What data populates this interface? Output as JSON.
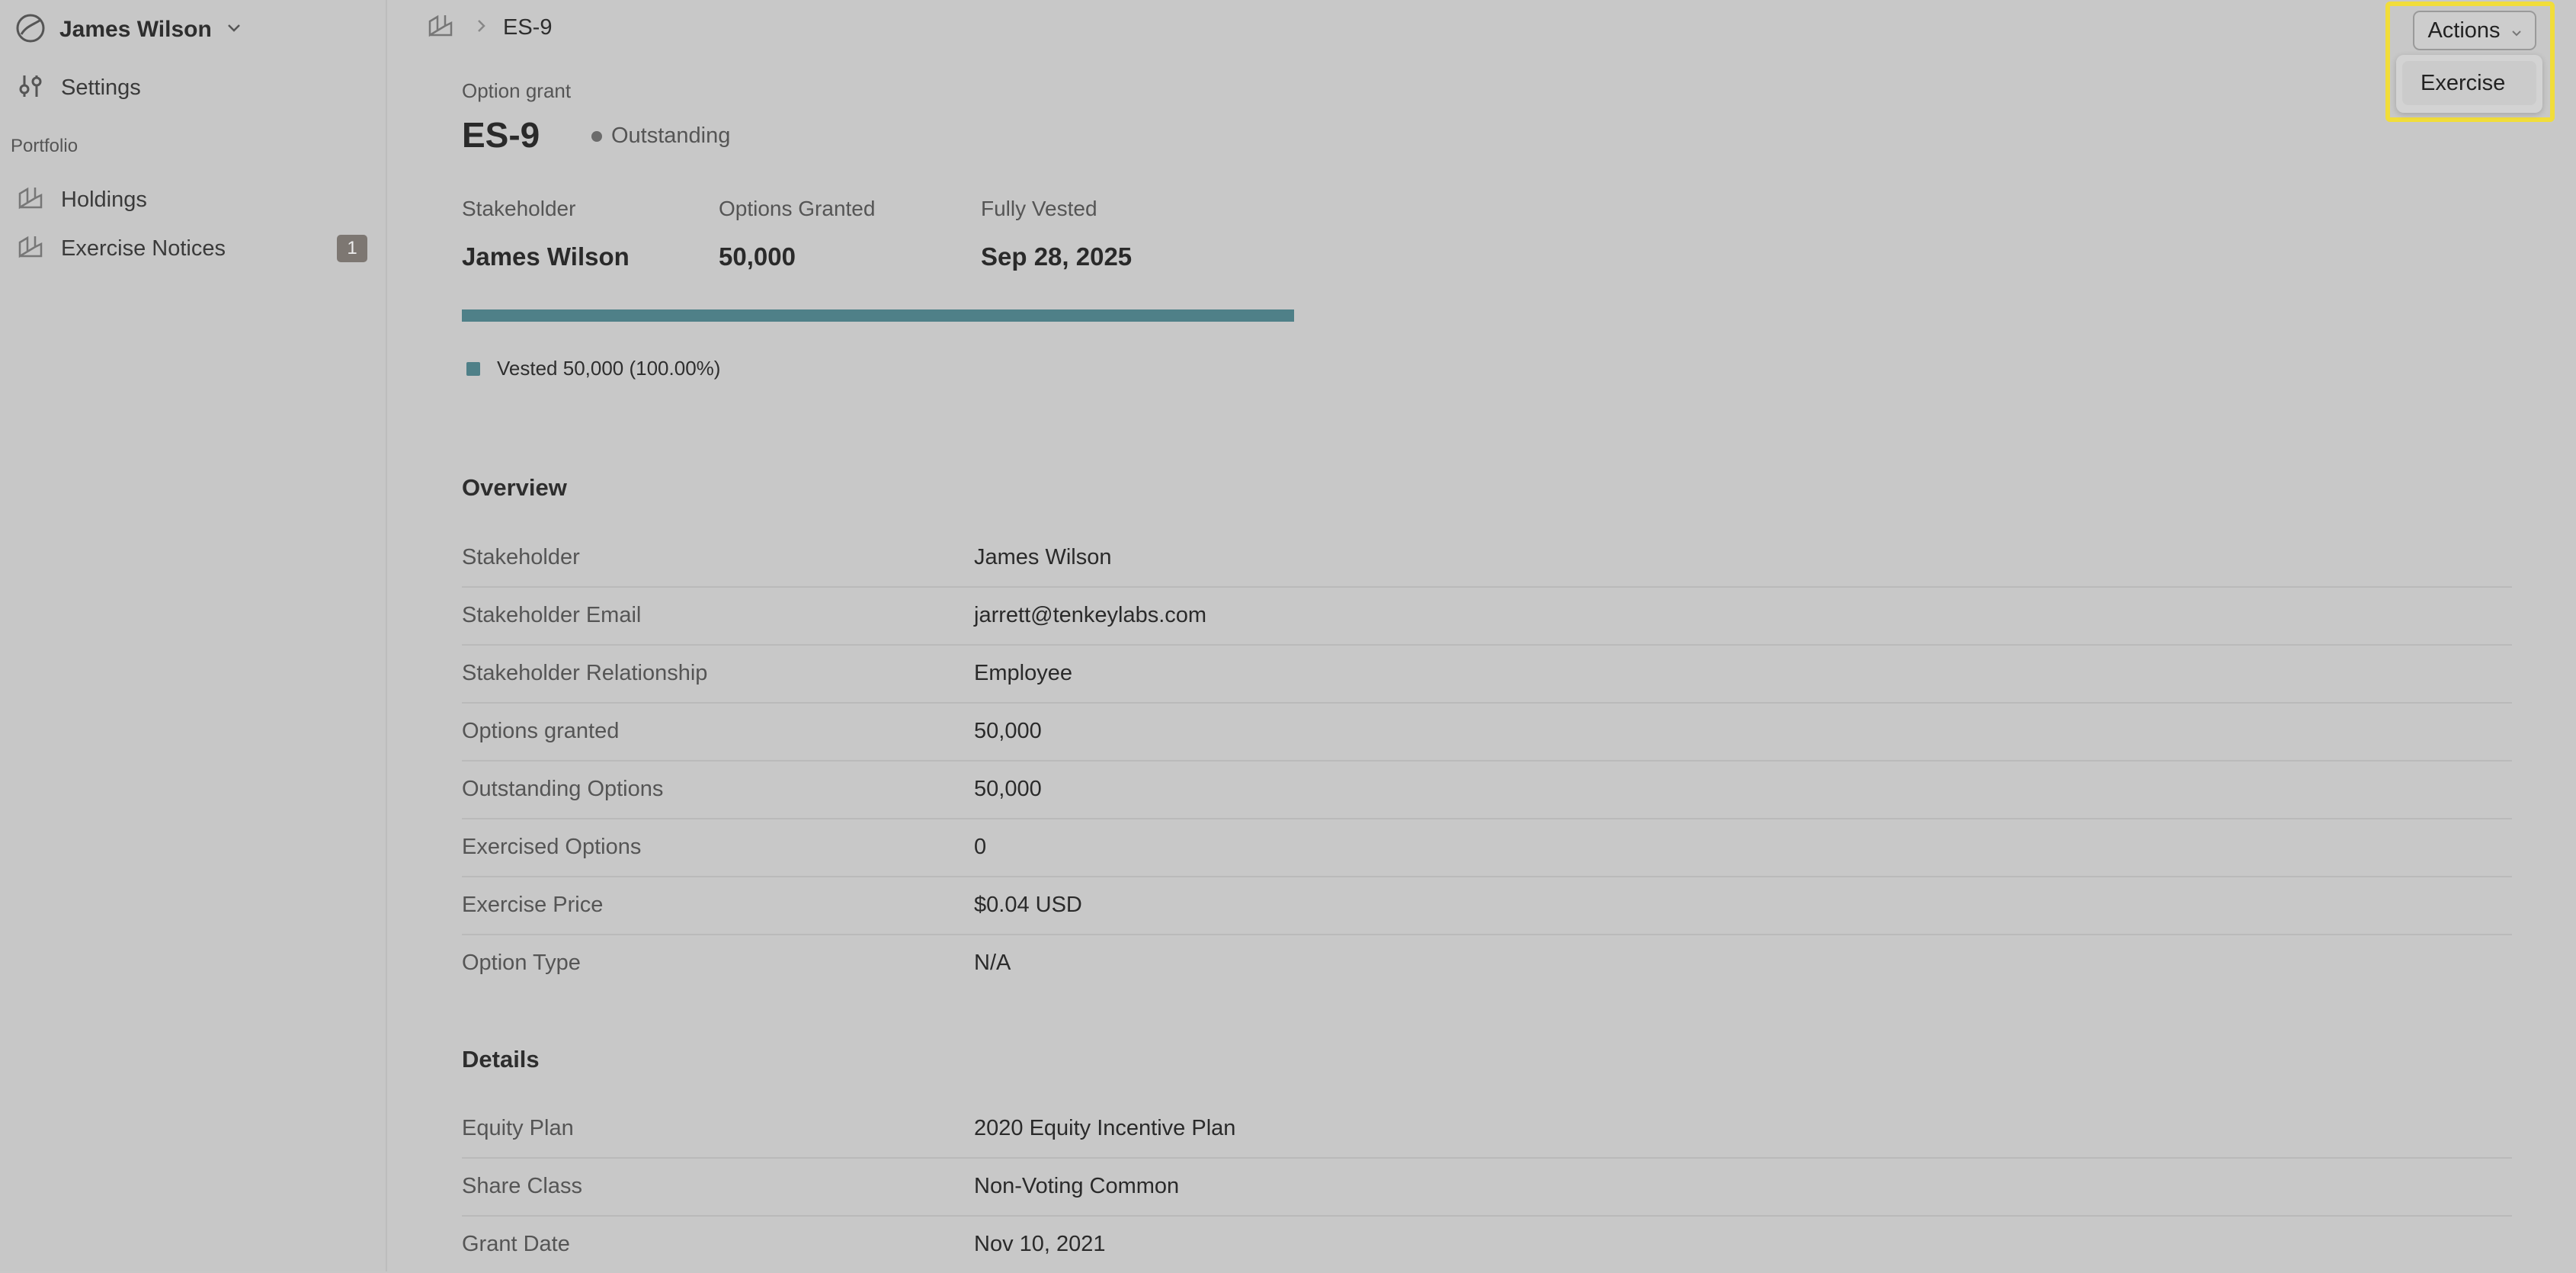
{
  "sidebar": {
    "user_name": "James Wilson",
    "settings_label": "Settings",
    "section_label": "Portfolio",
    "items": [
      {
        "label": "Holdings"
      },
      {
        "label": "Exercise Notices",
        "badge": "1"
      }
    ]
  },
  "breadcrumb": {
    "current": "ES-9"
  },
  "actions": {
    "button_label": "Actions",
    "menu_items": [
      "Exercise"
    ]
  },
  "grant": {
    "kicker": "Option grant",
    "title": "ES-9",
    "status": "Outstanding",
    "stats": [
      {
        "label": "Stakeholder",
        "value": "James Wilson"
      },
      {
        "label": "Options Granted",
        "value": "50,000"
      },
      {
        "label": "Fully Vested",
        "value": "Sep 28, 2025"
      }
    ],
    "vested_fraction": 1.0,
    "legend_label": "Vested 50,000 (100.00%)"
  },
  "overview": {
    "heading": "Overview",
    "rows": [
      {
        "k": "Stakeholder",
        "v": "James Wilson"
      },
      {
        "k": "Stakeholder Email",
        "v": "jarrett@tenkeylabs.com"
      },
      {
        "k": "Stakeholder Relationship",
        "v": "Employee"
      },
      {
        "k": "Options granted",
        "v": "50,000"
      },
      {
        "k": "Outstanding Options",
        "v": "50,000"
      },
      {
        "k": "Exercised Options",
        "v": "0"
      },
      {
        "k": "Exercise Price",
        "v": "$0.04 USD"
      },
      {
        "k": "Option Type",
        "v": "N/A"
      }
    ]
  },
  "details": {
    "heading": "Details",
    "rows": [
      {
        "k": "Equity Plan",
        "v": "2020 Equity Incentive Plan"
      },
      {
        "k": "Share Class",
        "v": "Non-Voting Common"
      },
      {
        "k": "Grant Date",
        "v": "Nov 10, 2021"
      }
    ]
  },
  "colors": {
    "accent": "#4f8088",
    "highlight": "#f1dd3a",
    "badge": "#7d7772"
  }
}
